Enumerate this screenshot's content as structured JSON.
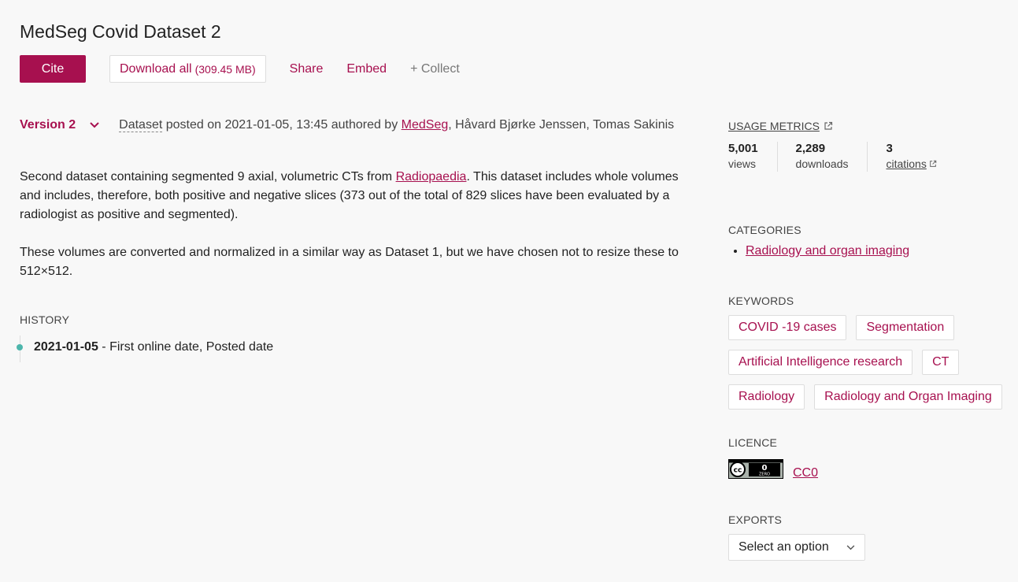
{
  "title": "MedSeg Covid Dataset 2",
  "actions": {
    "cite": "Cite",
    "download": "Download all",
    "download_size": "(309.45 MB)",
    "share": "Share",
    "embed": "Embed",
    "collect": "+ Collect"
  },
  "version": {
    "label": "Version 2",
    "item_type": "Dataset",
    "posted_text": "posted on 2021-01-05, 13:45 authored by",
    "author_link": "MedSeg",
    "authors_rest": ", Håvard Bjørke Jenssen, Tomas Sakinis"
  },
  "description": {
    "p1_before": "Second dataset containing segmented 9 axial, volumetric CTs from ",
    "p1_link": "Radiopaedia",
    "p1_after": ". This dataset includes whole volumes and includes, therefore, both positive and negative slices (373 out of the total of 829 slices have been evaluated by a radiologist as positive and segmented).",
    "p2": "These volumes are converted and normalized in a similar way as Dataset 1, but we have chosen not to resize these to 512×512."
  },
  "history": {
    "heading": "HISTORY",
    "items": [
      {
        "date": "2021-01-05",
        "text": "- First online date, Posted date"
      }
    ]
  },
  "usage": {
    "heading": "USAGE METRICS",
    "metrics": [
      {
        "value": "5,001",
        "label": "views"
      },
      {
        "value": "2,289",
        "label": "downloads"
      },
      {
        "value": "3",
        "label": "citations"
      }
    ]
  },
  "categories": {
    "heading": "CATEGORIES",
    "items": [
      "Radiology and organ imaging"
    ]
  },
  "keywords": {
    "heading": "KEYWORDS",
    "items": [
      "COVID -19 cases",
      "Segmentation",
      "Artificial Intelligence research",
      "CT",
      "Radiology",
      "Radiology and Organ Imaging"
    ]
  },
  "licence": {
    "heading": "LICENCE",
    "badge_text": "ZERO",
    "link": "CC0"
  },
  "exports": {
    "heading": "EXPORTS",
    "selected": "Select an option"
  },
  "colors": {
    "accent": "#a7104f",
    "background": "#f8f8f8",
    "history_dot": "#4db6ac"
  },
  "icons": {
    "version_toggle": "chevron-down-icon",
    "external_link": "external-link-icon",
    "select_toggle": "chevron-down-icon"
  }
}
